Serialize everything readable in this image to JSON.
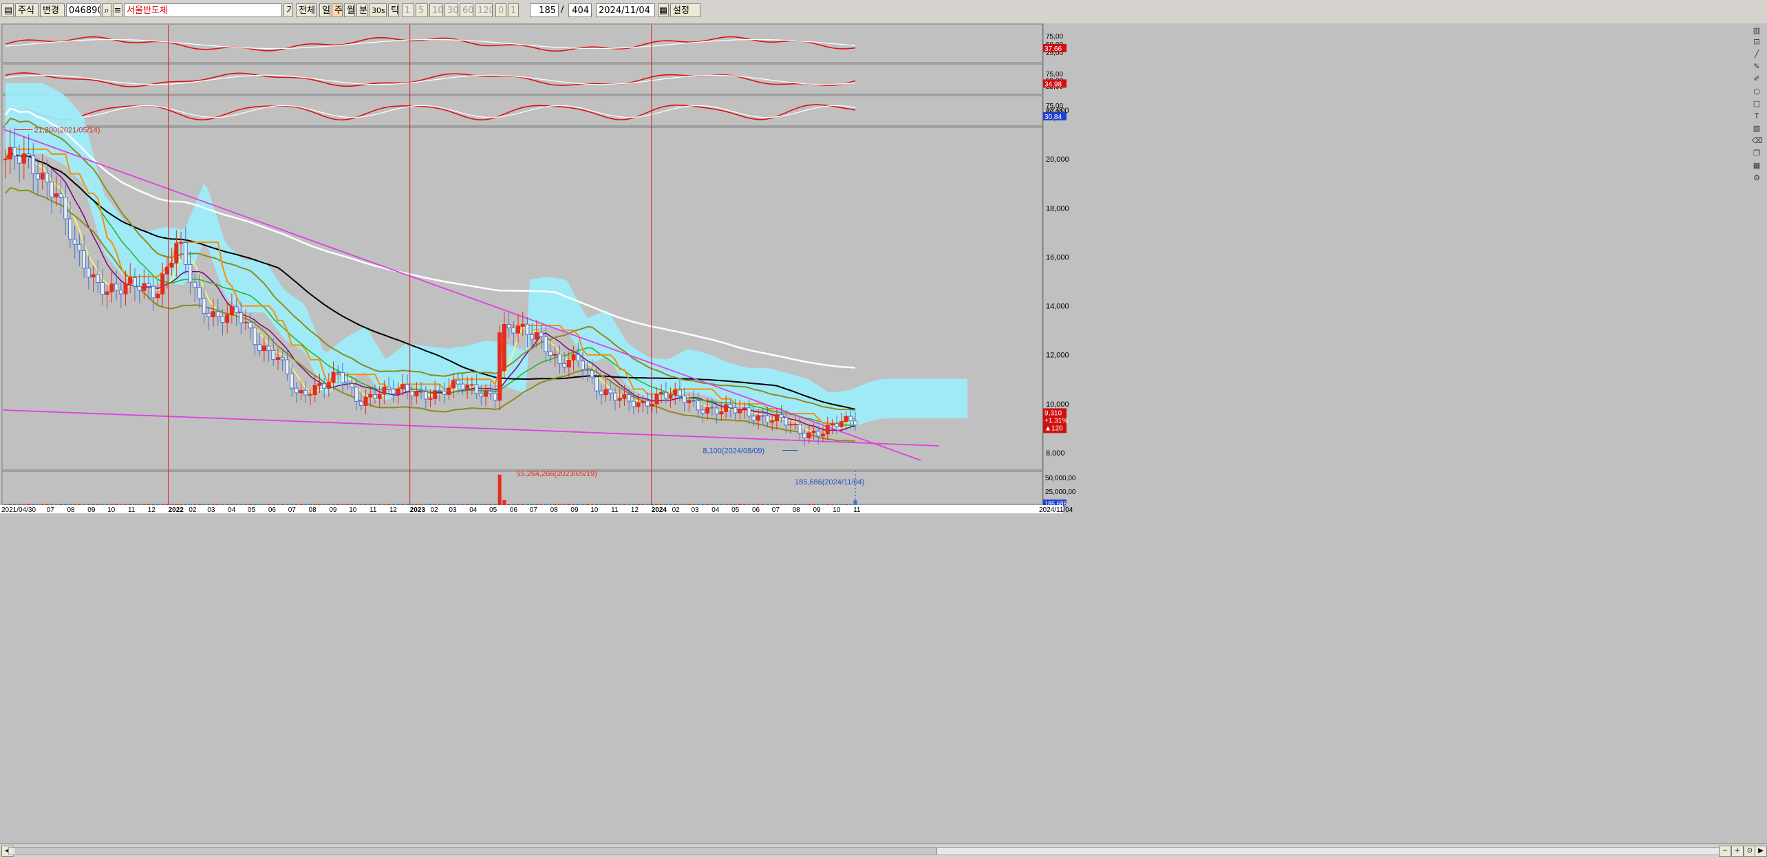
{
  "toolbar": {
    "market": "주식",
    "change": "변경",
    "code": "046890",
    "name": "서울반도체",
    "period_type": "기",
    "all": "전체",
    "periods": [
      "일",
      "주",
      "월",
      "분",
      "30s",
      "틱"
    ],
    "minute_buttons": [
      "1",
      "5",
      "10",
      "30",
      "60",
      "120",
      "0",
      "1"
    ],
    "count": "185",
    "total": "404",
    "date": "2024/11/04",
    "settings": "설정"
  },
  "price_panel": {
    "y_ticks": [
      "22,000",
      "20,000",
      "18,000",
      "16,000",
      "14,000",
      "12,000",
      "10,000",
      "8,000"
    ],
    "last_price": "9,310",
    "change_pct": "+1.31%",
    "change_abs": "▲120",
    "high_annotation": "21,200(2021/05/14)",
    "low_annotation": "8,100(2024/08/09)"
  },
  "osc_panels": [
    {
      "ticks": [
        "75,00",
        "50,00",
        "25,00"
      ],
      "value": "37,66"
    },
    {
      "ticks": [
        "75,00",
        "50,00",
        "25,00"
      ],
      "value": "34,98"
    },
    {
      "ticks": [
        "75,00",
        "50,00",
        "25,00"
      ],
      "value": "30,84"
    }
  ],
  "volume_panel": {
    "y_ticks": [
      "50,000,00",
      "25,000,00"
    ],
    "last_volume": "185,686",
    "max_annotation": "55,264,266(2023/05/19)",
    "last_annotation": "185,686(2024/11/04)"
  },
  "x_axis": {
    "labels": [
      "2021/04/30",
      "07",
      "08",
      "09",
      "10",
      "11",
      "12",
      "2022",
      "02",
      "03",
      "04",
      "05",
      "06",
      "07",
      "08",
      "09",
      "10",
      "11",
      "12",
      "2023",
      "02",
      "03",
      "04",
      "05",
      "06",
      "07",
      "08",
      "09",
      "10",
      "11",
      "12",
      "2024",
      "02",
      "03",
      "04",
      "05",
      "06",
      "07",
      "08",
      "09",
      "10",
      "11"
    ],
    "end_label": "2024/11/04"
  },
  "colors": {
    "bg": "#c0c0c0",
    "cloud": "#9beefc",
    "up": "#e42b1c",
    "down": "#4a74c9",
    "trend": "#e040e0",
    "ma_black": "#000000",
    "ma_white": "#ffffff",
    "bollinger": "#8b8b1a",
    "kijun": "#ff8c00",
    "tenkan": "#ffff60",
    "ma_purple": "#800080",
    "ma_green": "#1db81d",
    "osc_main": "#e01010",
    "osc_signal": "#ffffff",
    "osc_fill": "#7ef0d0"
  },
  "chart_data": {
    "type": "candlestick",
    "title": "서울반도체",
    "x_range": [
      "2021/04/30",
      "2024/11/04"
    ],
    "y_range": [
      7800,
      22300
    ],
    "close_path": [
      {
        "date": "2021/05",
        "value": 20000
      },
      {
        "date": "2021/06",
        "value": 19600
      },
      {
        "date": "2021/07",
        "value": 18800
      },
      {
        "date": "2021/08",
        "value": 16000
      },
      {
        "date": "2021/09",
        "value": 15000
      },
      {
        "date": "2021/10",
        "value": 14600
      },
      {
        "date": "2021/11",
        "value": 14800
      },
      {
        "date": "2021/12",
        "value": 14700
      },
      {
        "date": "2022/01",
        "value": 16500
      },
      {
        "date": "2022/02",
        "value": 14200
      },
      {
        "date": "2022/03",
        "value": 13600
      },
      {
        "date": "2022/04",
        "value": 13600
      },
      {
        "date": "2022/05",
        "value": 12500
      },
      {
        "date": "2022/06",
        "value": 12000
      },
      {
        "date": "2022/07",
        "value": 10200
      },
      {
        "date": "2022/08",
        "value": 10800
      },
      {
        "date": "2022/09",
        "value": 11200
      },
      {
        "date": "2022/10",
        "value": 10000
      },
      {
        "date": "2022/11",
        "value": 10600
      },
      {
        "date": "2022/12",
        "value": 10500
      },
      {
        "date": "2023/01",
        "value": 10400
      },
      {
        "date": "2023/02",
        "value": 10500
      },
      {
        "date": "2023/03",
        "value": 10700
      },
      {
        "date": "2023/04",
        "value": 10600
      },
      {
        "date": "2023/05",
        "value": 10300
      },
      {
        "date": "2023/05/19",
        "value": 12900
      },
      {
        "date": "2023/06",
        "value": 13000
      },
      {
        "date": "2023/07",
        "value": 12900
      },
      {
        "date": "2023/08",
        "value": 11500
      },
      {
        "date": "2023/09",
        "value": 11800
      },
      {
        "date": "2023/10",
        "value": 10600
      },
      {
        "date": "2023/11",
        "value": 10100
      },
      {
        "date": "2023/12",
        "value": 10000
      },
      {
        "date": "2024/01",
        "value": 10400
      },
      {
        "date": "2024/02",
        "value": 10200
      },
      {
        "date": "2024/03",
        "value": 9900
      },
      {
        "date": "2024/04",
        "value": 9700
      },
      {
        "date": "2024/05",
        "value": 9700
      },
      {
        "date": "2024/06",
        "value": 9500
      },
      {
        "date": "2024/07",
        "value": 9300
      },
      {
        "date": "2024/08",
        "value": 8800
      },
      {
        "date": "2024/09",
        "value": 8900
      },
      {
        "date": "2024/10",
        "value": 9200
      },
      {
        "date": "2024/11/04",
        "value": 9310
      }
    ],
    "high": {
      "date": "2021/05/14",
      "value": 21200
    },
    "low": {
      "date": "2024/08/09",
      "value": 8100
    },
    "volume": {
      "max": {
        "date": "2023/05/19",
        "value": 55264266
      },
      "last": {
        "date": "2024/11/04",
        "value": 185686
      }
    },
    "legend": "none",
    "grid": false
  }
}
